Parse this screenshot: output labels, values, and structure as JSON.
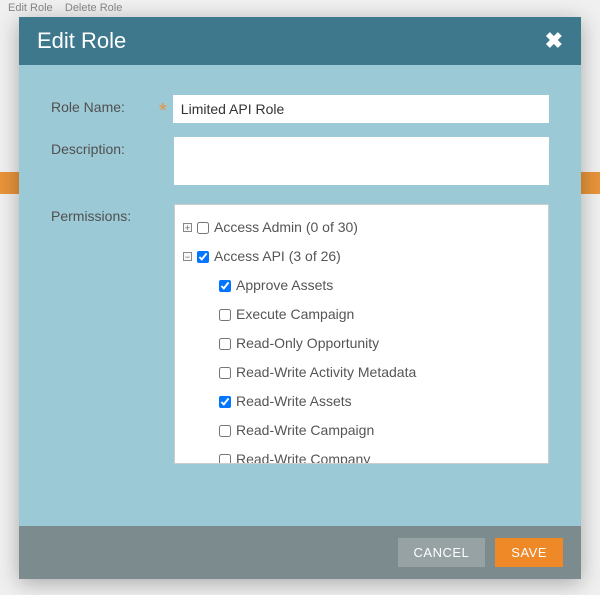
{
  "dialog": {
    "title": "Edit Role",
    "labels": {
      "roleName": "Role Name:",
      "description": "Description:",
      "permissions": "Permissions:"
    },
    "fields": {
      "roleName": "Limited API Role",
      "description": ""
    },
    "tree": [
      {
        "label": "Access Admin (0 of 30)",
        "expanded": false,
        "checked": false
      },
      {
        "label": "Access API (3 of 26)",
        "expanded": true,
        "checked": true,
        "children": [
          {
            "label": "Approve Assets",
            "checked": true
          },
          {
            "label": "Execute Campaign",
            "checked": false
          },
          {
            "label": "Read-Only Opportunity",
            "checked": false
          },
          {
            "label": "Read-Write Activity Metadata",
            "checked": false
          },
          {
            "label": "Read-Write Assets",
            "checked": true
          },
          {
            "label": "Read-Write Campaign",
            "checked": false
          },
          {
            "label": "Read-Write Company",
            "checked": false
          }
        ]
      }
    ],
    "buttons": {
      "cancel": "CANCEL",
      "save": "SAVE"
    }
  },
  "background": {
    "editRole": "Edit Role",
    "deleteRole": "Delete Role"
  }
}
